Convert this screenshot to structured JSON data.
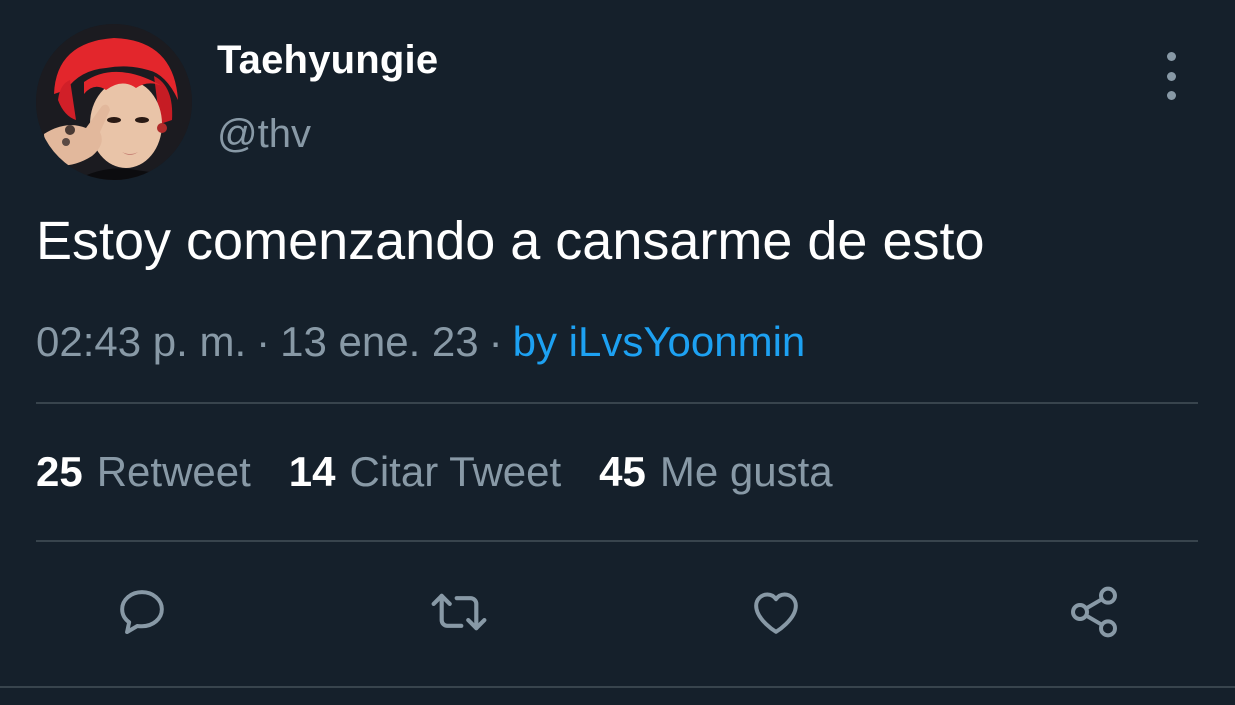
{
  "user": {
    "display_name": "Taehyungie",
    "handle": "@thv",
    "avatar_icon": "profile-photo-red-hair"
  },
  "tweet": {
    "text": "Estoy comenzando a cansarme de esto",
    "time": "02:43 p. m.",
    "separator_1": "·",
    "date": "13 ene. 23",
    "separator_2": "·",
    "source": "by iLvsYoonmin"
  },
  "stats": {
    "retweets": {
      "count": "25",
      "label": "Retweet"
    },
    "quotes": {
      "count": "14",
      "label": "Citar Tweet"
    },
    "likes": {
      "count": "45",
      "label": "Me gusta"
    }
  },
  "actions": [
    {
      "icon": "reply-icon"
    },
    {
      "icon": "retweet-icon"
    },
    {
      "icon": "like-icon"
    },
    {
      "icon": "share-icon"
    }
  ],
  "colors": {
    "background": "#15202b",
    "primary_text": "#ffffff",
    "secondary_text": "#8899a6",
    "link": "#1da1f2",
    "divider": "#38444d"
  }
}
